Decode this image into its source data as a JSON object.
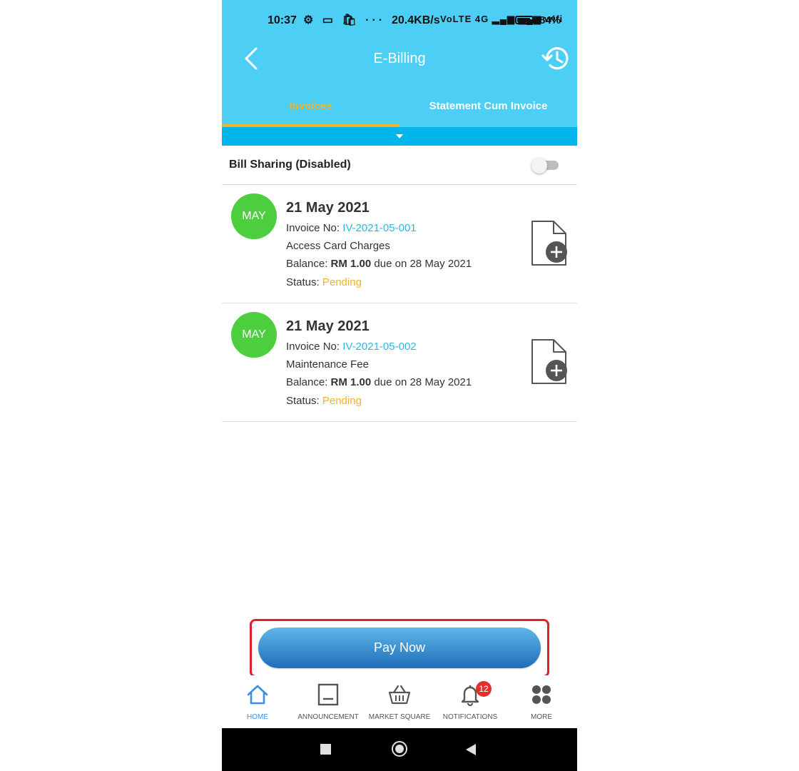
{
  "status_bar": {
    "time": "10:37",
    "icons": "⚙ ▭ 🛍 ···",
    "speed": "20.4KB/s",
    "network": "VoLTE 4G ▂▄▆ ▂▄▆ wifi",
    "battery_percent": "84%"
  },
  "header": {
    "title": "E-Billing",
    "back_icon": "chevron-left-icon",
    "history_icon": "history-icon",
    "background": "#4dcff5"
  },
  "tabs": [
    {
      "label": "Invoices",
      "active": true
    },
    {
      "label": "Statement Cum Invoice",
      "active": false
    }
  ],
  "bill_sharing": {
    "label": "Bill Sharing (Disabled)",
    "enabled": false
  },
  "invoices": [
    {
      "month": "MAY",
      "date": "21 May 2021",
      "invoice_prefix": "Invoice No: ",
      "invoice_no": "IV-2021-05-001",
      "description": "Access Card Charges",
      "balance_prefix": "Balance: ",
      "balance_amount": "RM 1.00",
      "due_text": " due on 28 May 2021",
      "status_prefix": "Status: ",
      "status": "Pending"
    },
    {
      "month": "MAY",
      "date": "21 May 2021",
      "invoice_prefix": "Invoice No: ",
      "invoice_no": "IV-2021-05-002",
      "description": "Maintenance Fee",
      "balance_prefix": "Balance: ",
      "balance_amount": "RM 1.00",
      "due_text": " due on 28 May 2021",
      "status_prefix": "Status: ",
      "status": "Pending"
    }
  ],
  "pay_button": {
    "label": "Pay Now"
  },
  "bottom_nav": [
    {
      "label": "HOME",
      "icon": "home-icon",
      "active": true
    },
    {
      "label": "ANNOUNCEMENT",
      "icon": "announcement-icon",
      "active": false
    },
    {
      "label": "MARKET SQUARE",
      "icon": "basket-icon",
      "active": false
    },
    {
      "label": "NOTIFICATIONS",
      "icon": "bell-icon",
      "active": false,
      "badge": "12"
    },
    {
      "label": "MORE",
      "icon": "grid-icon",
      "active": false
    }
  ],
  "colors": {
    "accent": "#f0b32a",
    "link": "#2bb8e0",
    "month_circle": "#4cce3e",
    "highlight_frame": "#e0202a"
  }
}
